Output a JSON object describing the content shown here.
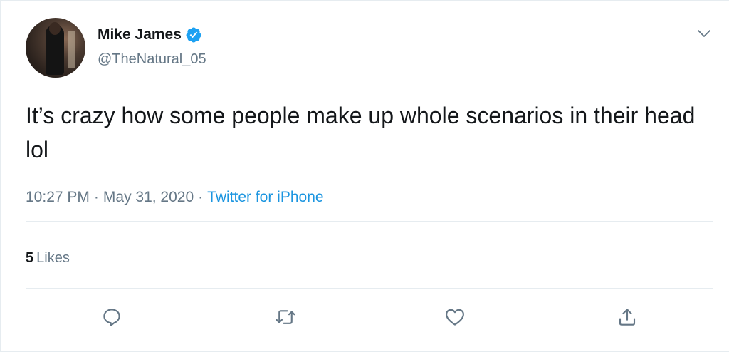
{
  "user": {
    "display_name": "Mike James",
    "handle": "@TheNatural_05",
    "verified": true
  },
  "tweet": {
    "text": "It’s crazy how some people make up whole scenarios in their head lol",
    "time": "10:27 PM",
    "separator": "·",
    "date": "May 31, 2020",
    "source": "Twitter for iPhone"
  },
  "stats": {
    "likes_count": "5",
    "likes_label": "Likes"
  },
  "icons": {
    "verified": "verified-badge-icon",
    "menu": "chevron-down-icon",
    "reply": "reply-icon",
    "retweet": "retweet-icon",
    "like": "heart-icon",
    "share": "share-icon"
  },
  "colors": {
    "text": "#14171a",
    "secondary": "#657786",
    "link": "#1b95e0",
    "verified": "#1da1f2",
    "divider": "#e6ecf0"
  }
}
